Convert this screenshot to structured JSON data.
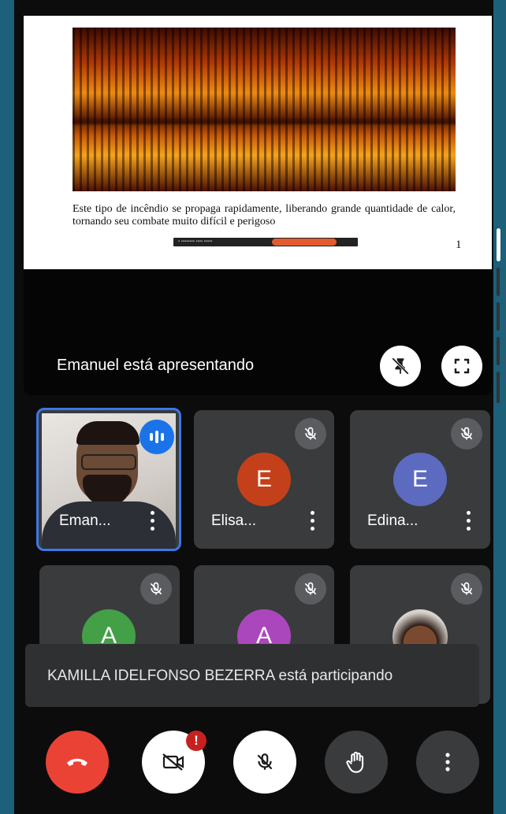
{
  "slide": {
    "caption": "Este tipo de incêndio se propaga rapidamente, liberando grande quantidade de calor, tornando seu combate muito difícil e perigoso",
    "page_number": "1"
  },
  "presentation": {
    "label": "Emanuel está apresentando"
  },
  "participants": [
    {
      "name": "Eman...",
      "initial": "",
      "color": "",
      "speaking": true
    },
    {
      "name": "Elisa...",
      "initial": "E",
      "color": "#c4401b",
      "muted": true
    },
    {
      "name": "Edina...",
      "initial": "E",
      "color": "#5c6bc0",
      "muted": true
    },
    {
      "name": "",
      "initial": "A",
      "color": "#43a047",
      "muted": true
    },
    {
      "name": "",
      "initial": "A",
      "color": "#ab47bc",
      "muted": true
    },
    {
      "name": "",
      "initial": "",
      "color": "",
      "muted": true
    }
  ],
  "toast": {
    "message": "KAMILLA IDELFONSO BEZERRA está participando"
  },
  "controls": {
    "end_call_color": "#ea4335",
    "camera_alert_badge": "!"
  }
}
